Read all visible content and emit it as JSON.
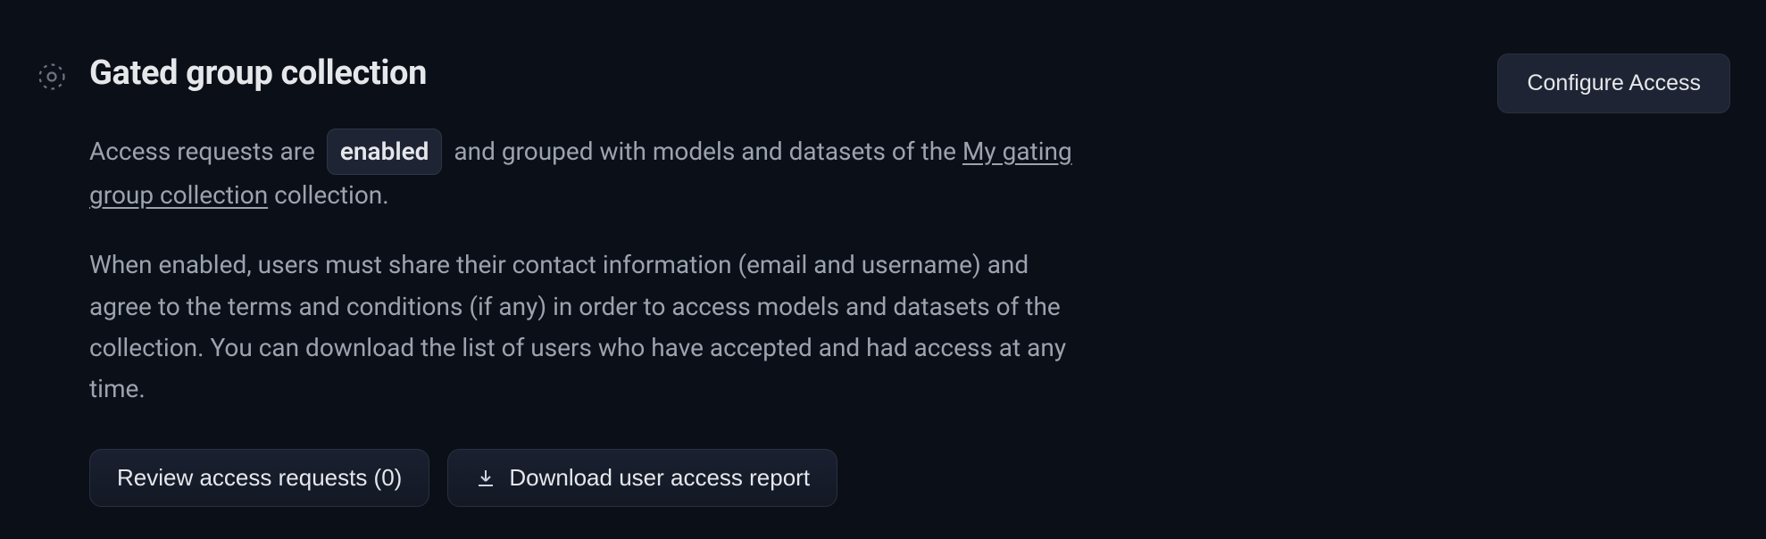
{
  "header": {
    "title": "Gated group collection",
    "configure_label": "Configure Access"
  },
  "status_line": {
    "prefix": "Access requests are",
    "badge": "enabled",
    "middle": "and grouped with models and datasets of the",
    "link_text": "My gating group collection",
    "suffix": "collection."
  },
  "description": "When enabled, users must share their contact information (email and username) and agree to the terms and conditions (if any) in order to access models and datasets of the collection. You can download the list of users who have accepted and had access at any time.",
  "actions": {
    "review_label": "Review access requests (0)",
    "download_label": "Download user access report"
  }
}
